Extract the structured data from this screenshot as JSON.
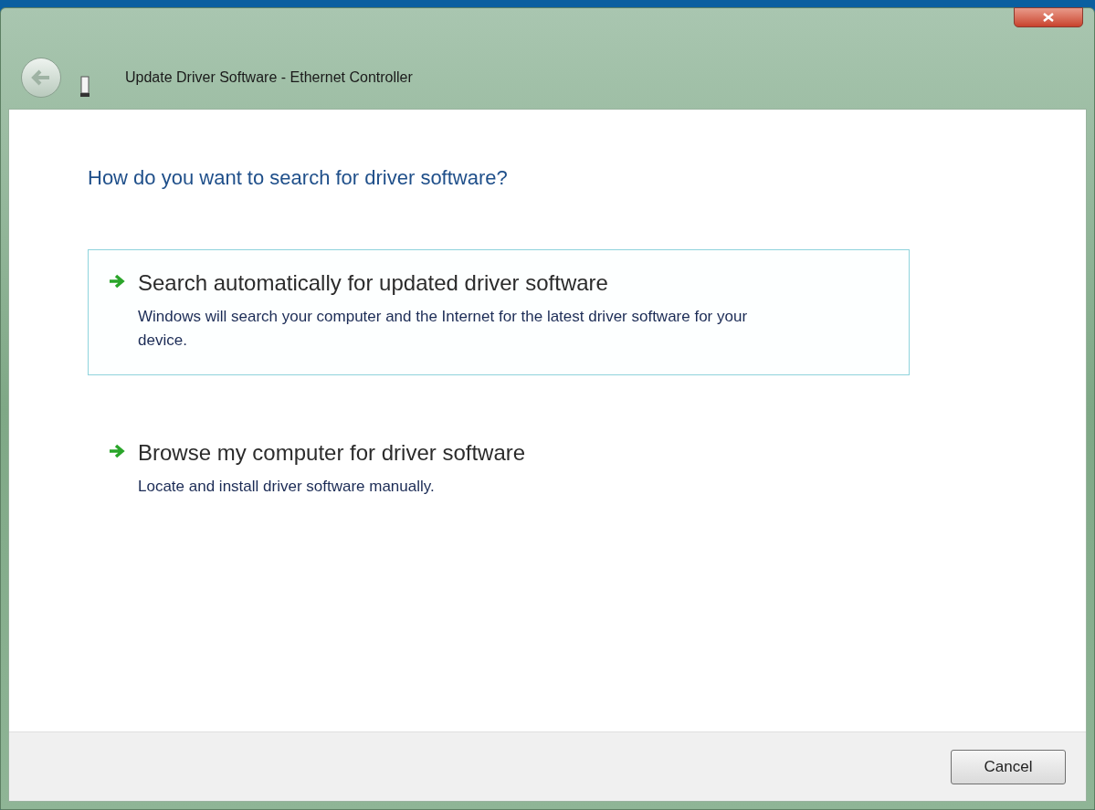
{
  "window": {
    "title": "Update Driver Software - Ethernet Controller"
  },
  "heading": "How do you want to search for driver software?",
  "options": [
    {
      "title": "Search automatically for updated driver software",
      "description": "Windows will search your computer and the Internet for the latest driver software for your device.",
      "selected": true
    },
    {
      "title": "Browse my computer for driver software",
      "description": "Locate and install driver software manually.",
      "selected": false
    }
  ],
  "buttons": [
    "Cancel"
  ]
}
